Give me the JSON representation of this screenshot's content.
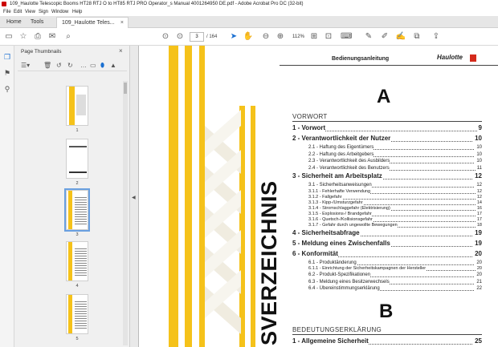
{
  "window": {
    "title": "109_Haulotte Telescopic Booms HT28 RTJ O to HT85 RTJ PRO Operator_s Manual 4001264950 DE.pdf - Adobe Acrobat Pro DC (32-bit)"
  },
  "menu": {
    "items": [
      "File",
      "Edit",
      "View",
      "Sign",
      "Window",
      "Help"
    ]
  },
  "tabs": {
    "home": "Home",
    "tools": "Tools",
    "doc": "109_Haulotte Teles...",
    "doc_close": "×"
  },
  "toolbar": {
    "page_current": "3",
    "page_total": "/ 164",
    "zoom": "112%"
  },
  "panel": {
    "title": "Page Thumbnails",
    "close": "×",
    "thumbnails": [
      "1",
      "2",
      "3",
      "4",
      "5"
    ],
    "selected": "3"
  },
  "page": {
    "header_text": "Bedienungsanleitung",
    "logo_text": "Haulotte",
    "letter_a": "A",
    "letter_b": "B",
    "vertical_title": "SVERZEICHNIS",
    "sections": {
      "vorwort": "VORWORT",
      "bedeutung": "BEDEUTUNGSERKLÄRUNG"
    },
    "toc_a": [
      {
        "level": 1,
        "text": "1 - Vorwort",
        "page": "9"
      },
      {
        "level": 1,
        "text": "2 - Verantwortlichkeit der Nutzer",
        "page": "10"
      },
      {
        "level": 2,
        "text": "2.1 -     Haftung des Eigentümers",
        "page": "10"
      },
      {
        "level": 2,
        "text": "2.2 -     Haftung des Arbeitgebers",
        "page": "10"
      },
      {
        "level": 2,
        "text": "2.3 -     Verantwortlichkeit des Ausbilders",
        "page": "10"
      },
      {
        "level": 2,
        "text": "2.4 -     Verantwortlichkeit des Benutzers",
        "page": "11"
      },
      {
        "level": 1,
        "text": "3 - Sicherheit am Arbeitsplatz",
        "page": "12"
      },
      {
        "level": 2,
        "text": "3.1 -     Sicherheitsanweisungen",
        "page": "12"
      },
      {
        "level": 3,
        "text": "3.1.1 -       Fehlerhafte Verwendung",
        "page": "12"
      },
      {
        "level": 3,
        "text": "3.1.2 -       Fallgefahr",
        "page": "12"
      },
      {
        "level": 3,
        "text": "3.1.3 -       Kipp-/Umsturzgefahr",
        "page": "14"
      },
      {
        "level": 3,
        "text": "3.1.4 -       Stromschlaggefahr (Elektrisierung)",
        "page": "16"
      },
      {
        "level": 3,
        "text": "3.1.5 -       Explosions-/ Brandgefahr",
        "page": "17"
      },
      {
        "level": 3,
        "text": "3.1.6 -       Quetsch-/Kollisionsgefahr",
        "page": "17"
      },
      {
        "level": 3,
        "text": "3.1.7 -       Gefahr durch ungewollte Bewegungen",
        "page": "18"
      },
      {
        "level": 1,
        "text": "4 - Sicherheitsabfrage",
        "page": "19"
      },
      {
        "level": 1,
        "text": "5 - Meldung eines Zwischenfalls",
        "page": "19"
      },
      {
        "level": 1,
        "text": "6 - Konformität",
        "page": "20"
      },
      {
        "level": 2,
        "text": "6.1 -     Produktänderung",
        "page": "20"
      },
      {
        "level": 3,
        "text": "6.1.1 -       Einrichtung der Sicherheitskampagnen der Hersteller",
        "page": "20"
      },
      {
        "level": 2,
        "text": "6.2 -     Produkt-Spezifikationen",
        "page": "20"
      },
      {
        "level": 2,
        "text": "6.3 -     Meldung eines Besitzerwechsels",
        "page": "21"
      },
      {
        "level": 2,
        "text": "6.4 -     Übereinstimmungserklärung",
        "page": "22"
      }
    ],
    "toc_b": [
      {
        "level": 1,
        "text": "1 - Allgemeine Sicherheit",
        "page": "25"
      }
    ]
  },
  "colors": {
    "yellow": "#f5c21a",
    "accent_blue": "#1a6fd1",
    "logo_red": "#d42a1c"
  }
}
